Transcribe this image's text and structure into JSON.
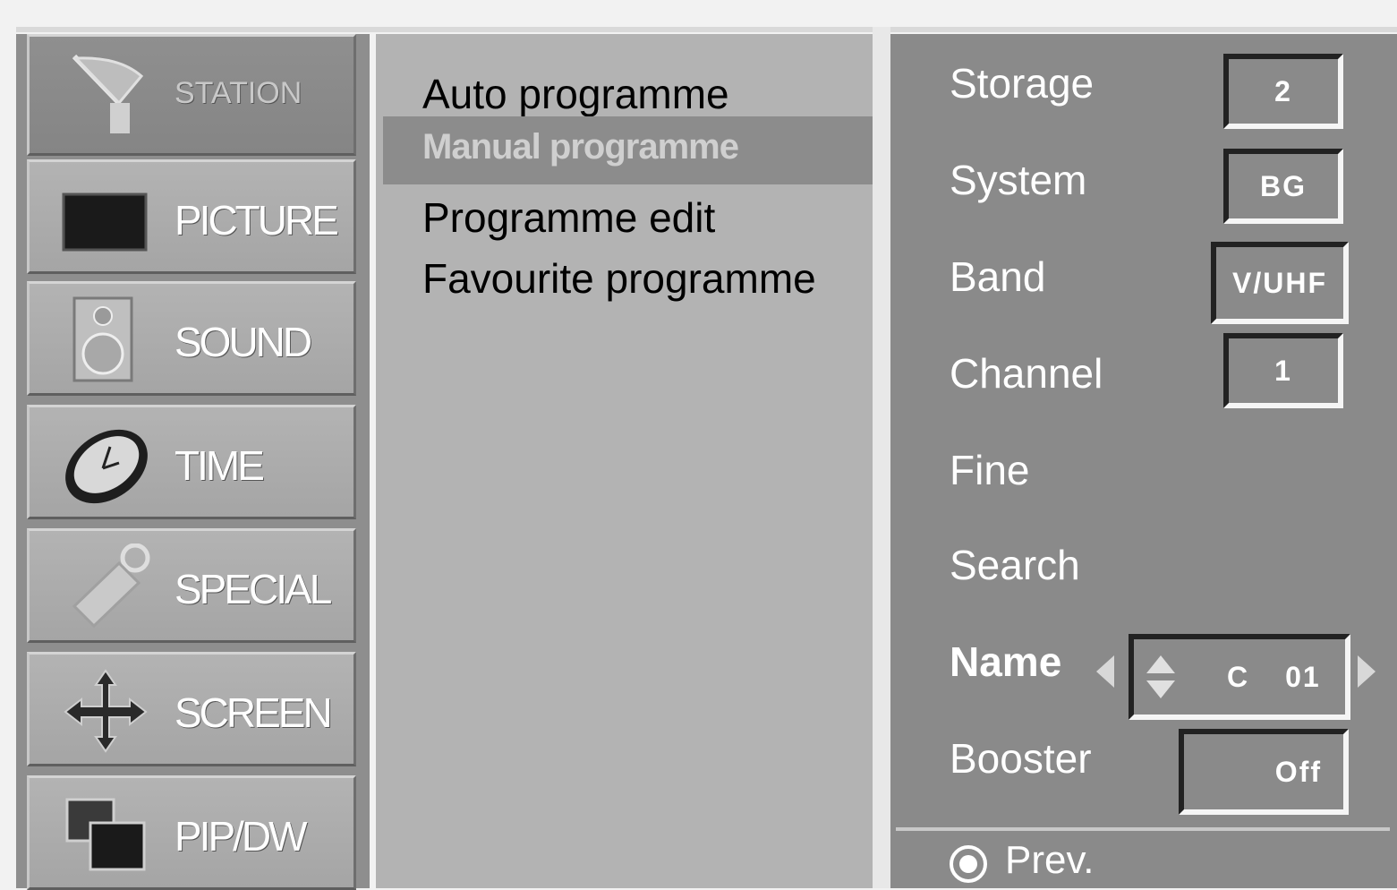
{
  "sidebar": {
    "items": [
      {
        "label": "STATION",
        "icon": "satellite-dish-icon",
        "active": true
      },
      {
        "label": "PICTURE",
        "icon": "picture-monitor-icon"
      },
      {
        "label": "SOUND",
        "icon": "speaker-icon"
      },
      {
        "label": "TIME",
        "icon": "clock-icon"
      },
      {
        "label": "SPECIAL",
        "icon": "remote-control-icon"
      },
      {
        "label": "SCREEN",
        "icon": "move-arrows-icon"
      },
      {
        "label": "PIP/DW",
        "icon": "pip-windows-icon"
      }
    ]
  },
  "middle": {
    "items": [
      {
        "label": "Auto programme"
      },
      {
        "label": "Manual programme",
        "selected": true
      },
      {
        "label": "Programme edit"
      },
      {
        "label": "Favourite programme"
      }
    ]
  },
  "settings": {
    "storage": {
      "label": "Storage",
      "value": "2"
    },
    "system": {
      "label": "System",
      "value": "BG"
    },
    "band": {
      "label": "Band",
      "value": "V/UHF"
    },
    "channel": {
      "label": "Channel",
      "value": "1"
    },
    "fine": {
      "label": "Fine"
    },
    "search": {
      "label": "Search"
    },
    "name": {
      "label": "Name",
      "value_letter": "C",
      "value_number": "01"
    },
    "booster": {
      "label": "Booster",
      "value": "Off"
    }
  },
  "footer": {
    "prev_label": "Prev.",
    "prev_icon": "ok-button-icon"
  },
  "colors": {
    "sidebar_bg": "#8e8e8e",
    "middle_bg": "#b3b3b3",
    "right_bg": "#8a8a8a",
    "highlight": "#8c8c8c"
  }
}
